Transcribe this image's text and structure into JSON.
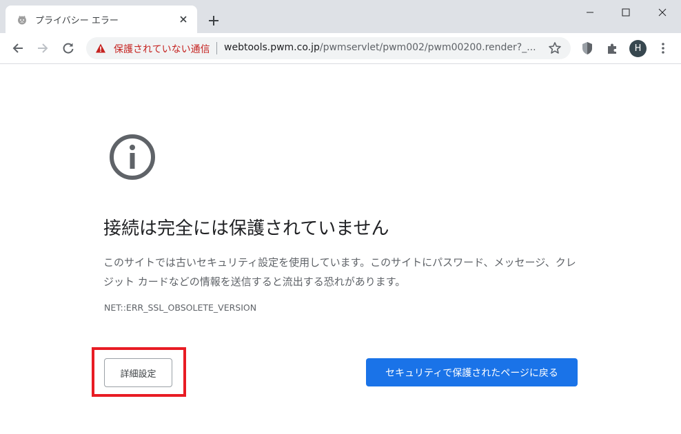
{
  "tab": {
    "title": "プライバシー エラー"
  },
  "omnibox": {
    "security_label": "保護されていない通信",
    "url_host": "webtools.pwm.co.jp",
    "url_path": "/pwmservlet/pwm002/pwm00200.render?_..."
  },
  "profile": {
    "initial": "H"
  },
  "page": {
    "heading": "接続は完全には保護されていません",
    "description": "このサイトでは古いセキュリティ設定を使用しています。このサイトにパスワード、メッセージ、クレジット カードなどの情報を送信すると流出する恐れがあります。",
    "error_code": "NET::ERR_SSL_OBSOLETE_VERSION",
    "details_button": "詳細設定",
    "back_button": "セキュリティで保護されたページに戻る"
  },
  "colors": {
    "tabstrip_bg": "#dee1e6",
    "not_secure_red": "#c5221f",
    "primary_blue": "#1a73e8",
    "highlight_red": "#e81c24",
    "avatar_bg": "#37474f"
  },
  "icons": {
    "tab_favicon": "warning-face-icon",
    "tab_close": "close-icon",
    "new_tab": "plus-icon",
    "minimize": "minimize-icon",
    "maximize": "maximize-icon",
    "close_window": "close-icon",
    "back": "arrow-left-icon",
    "forward": "arrow-right-icon",
    "reload": "reload-icon",
    "security": "warning-triangle-icon",
    "bookmark": "star-icon",
    "extension_shield": "shield-icon",
    "extensions": "puzzle-icon",
    "menu": "kebab-menu-icon",
    "page": "info-circle-icon"
  }
}
